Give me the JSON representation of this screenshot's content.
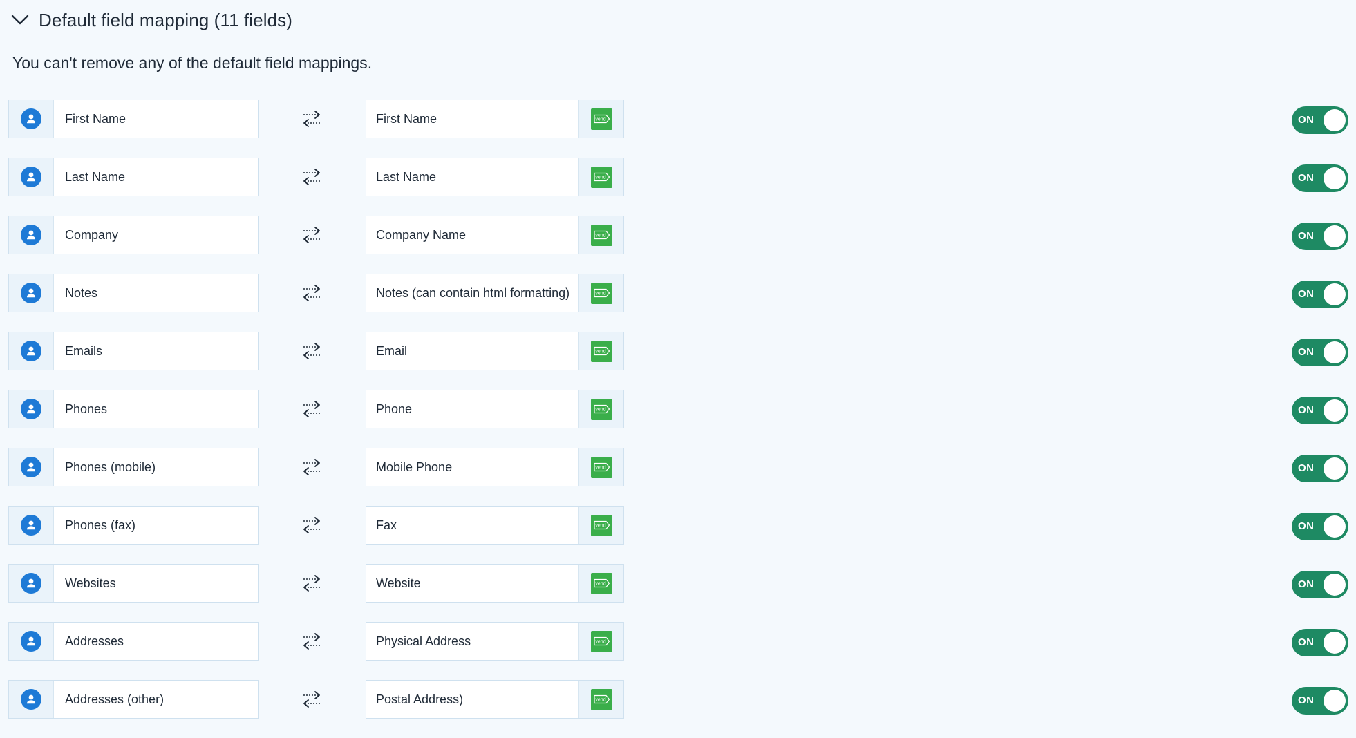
{
  "section": {
    "title": "Default field mapping (11 fields)",
    "description": "You can't remove any of the default field mappings.",
    "collapse_icon": "chevron-down-icon"
  },
  "icons": {
    "left_field": "person-icon",
    "sync": "sync-arrows-icon",
    "right_field": "vend-logo-icon"
  },
  "colors": {
    "person_icon": "#1e7ad6",
    "vend_icon": "#3aae4a",
    "toggle_on": "#1e8a63",
    "background": "#f4f9fd"
  },
  "logo_text": "vend",
  "mappings": [
    {
      "left": "First Name",
      "right": "First Name",
      "toggle": "ON"
    },
    {
      "left": "Last Name",
      "right": "Last Name",
      "toggle": "ON"
    },
    {
      "left": "Company",
      "right": "Company Name",
      "toggle": "ON"
    },
    {
      "left": "Notes",
      "right": "Notes (can contain html formatting)",
      "toggle": "ON"
    },
    {
      "left": "Emails",
      "right": "Email",
      "toggle": "ON"
    },
    {
      "left": "Phones",
      "right": "Phone",
      "toggle": "ON"
    },
    {
      "left": "Phones (mobile)",
      "right": "Mobile Phone",
      "toggle": "ON"
    },
    {
      "left": "Phones (fax)",
      "right": "Fax",
      "toggle": "ON"
    },
    {
      "left": "Websites",
      "right": "Website",
      "toggle": "ON"
    },
    {
      "left": "Addresses",
      "right": "Physical Address",
      "toggle": "ON"
    },
    {
      "left": "Addresses (other)",
      "right": "Postal Address)",
      "toggle": "ON"
    }
  ]
}
